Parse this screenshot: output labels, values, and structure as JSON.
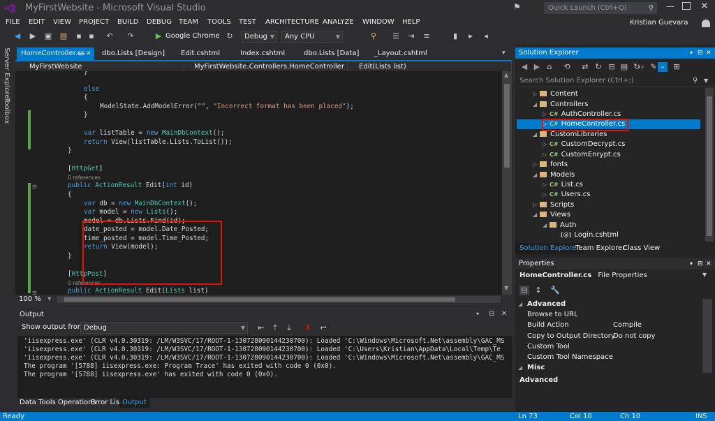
{
  "window": {
    "title": "MyFirstWebsite - Microsoft Visual Studio",
    "quick_launch_placeholder": "Quick Launch (Ctrl+Q)",
    "user_name": "Kristian Guevara"
  },
  "menu": [
    "FILE",
    "EDIT",
    "VIEW",
    "PROJECT",
    "BUILD",
    "DEBUG",
    "TEAM",
    "TOOLS",
    "TEST",
    "ARCHITECTURE",
    "ANALYZE",
    "WINDOW",
    "HELP"
  ],
  "toolbar": {
    "browser": "Google Chrome",
    "config": "Debug",
    "platform": "Any CPU"
  },
  "side_tabs": [
    "Server Explorer",
    "Toolbox"
  ],
  "doc_tabs": [
    "HomeController.cs",
    "dbo.Lists [Design]",
    "Edit.cshtml",
    "Index.cshtml",
    "dbo.Lists [Data]",
    "_Layout.cshtml"
  ],
  "nav": {
    "project": "MyFirstWebsite",
    "class": "MyFirstWebsite.Controllers.HomeController",
    "member": "Edit(Lists list)"
  },
  "code": {
    "l1": "}",
    "l2": "else",
    "l3": "{",
    "l4a": "ModelState.AddModelError(\"\", ",
    "l4b": "\"Incorrect format has been placed\"",
    "l4c": ");",
    "l5": "}",
    "l6a": "var",
    "l6b": " listTable = ",
    "l6c": "new",
    "l6d": " MainDbContext",
    "l6e": "();",
    "l7a": "return",
    "l7b": " View(listTable.Lists.ToList());",
    "l8": "}",
    "l9a": "[",
    "l9b": "HttpGet",
    "l9c": "]",
    "refs": "0 references",
    "l10a": "public",
    "l10b": " ActionResult",
    "l10c": " Edit(",
    "l10d": "int",
    "l10e": " id)",
    "l11": "{",
    "l12a": "var",
    "l12b": " db = ",
    "l12c": "new",
    "l12d": " MainDbContext",
    "l12e": "();",
    "l13a": "var",
    "l13b": " model = ",
    "l13c": "new",
    "l13d": " Lists",
    "l13e": "();",
    "l14": "model = db.Lists.Find(id);",
    "l15": "date_posted = model.Date_Posted;",
    "l16": "time_posted = model.Time_Posted;",
    "l17a": "return",
    "l17b": " View(model);",
    "l18": "}",
    "l19a": "[",
    "l19b": "HttpPost",
    "l19c": "]",
    "l20a": "public",
    "l20b": " ActionResult",
    "l20c": " Edit(",
    "l20d": "Lists",
    "l20e": " list)"
  },
  "zoom": "100 %",
  "output": {
    "title": "Output",
    "show_from_label": "Show output from:",
    "show_from_value": "Debug",
    "lines": [
      "'iisexpress.exe' (CLR v4.0.30319: /LM/W3SVC/17/ROOT-1-130728090144230700): Loaded 'C:\\Windows\\Microsoft.Net\\assembly\\GAC_MS",
      "'iisexpress.exe' (CLR v4.0.30319: /LM/W3SVC/17/ROOT-1-130728090144230700): Loaded 'C:\\Users\\Kristian\\AppData\\Local\\Temp\\Te",
      "'iisexpress.exe' (CLR v4.0.30319: /LM/W3SVC/17/ROOT-1-130728090144230700): Loaded 'C:\\Windows\\Microsoft.Net\\assembly\\GAC_MS",
      "The program '[5788] iisexpress.exe: Program Trace' has exited with code 0 (0x0).",
      "The program '[5788] iisexpress.exe' has exited with code 0 (0x0)."
    ],
    "tabs": [
      "Data Tools Operations",
      "Error List",
      "Output"
    ]
  },
  "solution_explorer": {
    "title": "Solution Explorer",
    "search_placeholder": "Search Solution Explorer (Ctrl+;)",
    "items": [
      "Content",
      "Controllers",
      "AuthController.cs",
      "HomeController.cs",
      "CustomLibraries",
      "CustomDecrypt.cs",
      "CustomEnrypt.cs",
      "fonts",
      "Models",
      "List.cs",
      "Users.cs",
      "Scripts",
      "Views",
      "Auth",
      "Login.cshtml"
    ],
    "bottom_tabs": [
      "Solution Explorer",
      "Team Explorer",
      "Class View"
    ]
  },
  "properties": {
    "title": "Properties",
    "object": "HomeController.cs",
    "object_type": "File Properties",
    "cat_advanced": "Advanced",
    "rows": [
      {
        "name": "Browse to URL",
        "value": ""
      },
      {
        "name": "Build Action",
        "value": "Compile"
      },
      {
        "name": "Copy to Output Directory",
        "value": "Do not copy"
      },
      {
        "name": "Custom Tool",
        "value": ""
      },
      {
        "name": "Custom Tool Namespace",
        "value": ""
      }
    ],
    "cat_misc": "Misc",
    "desc_title": "Advanced"
  },
  "status": {
    "ready": "Ready",
    "ln": "Ln 73",
    "col": "Col 10",
    "ch": "Ch 10",
    "ins": "INS"
  },
  "colors": {
    "accent": "#007acc",
    "highlight_box": "#e51400"
  }
}
